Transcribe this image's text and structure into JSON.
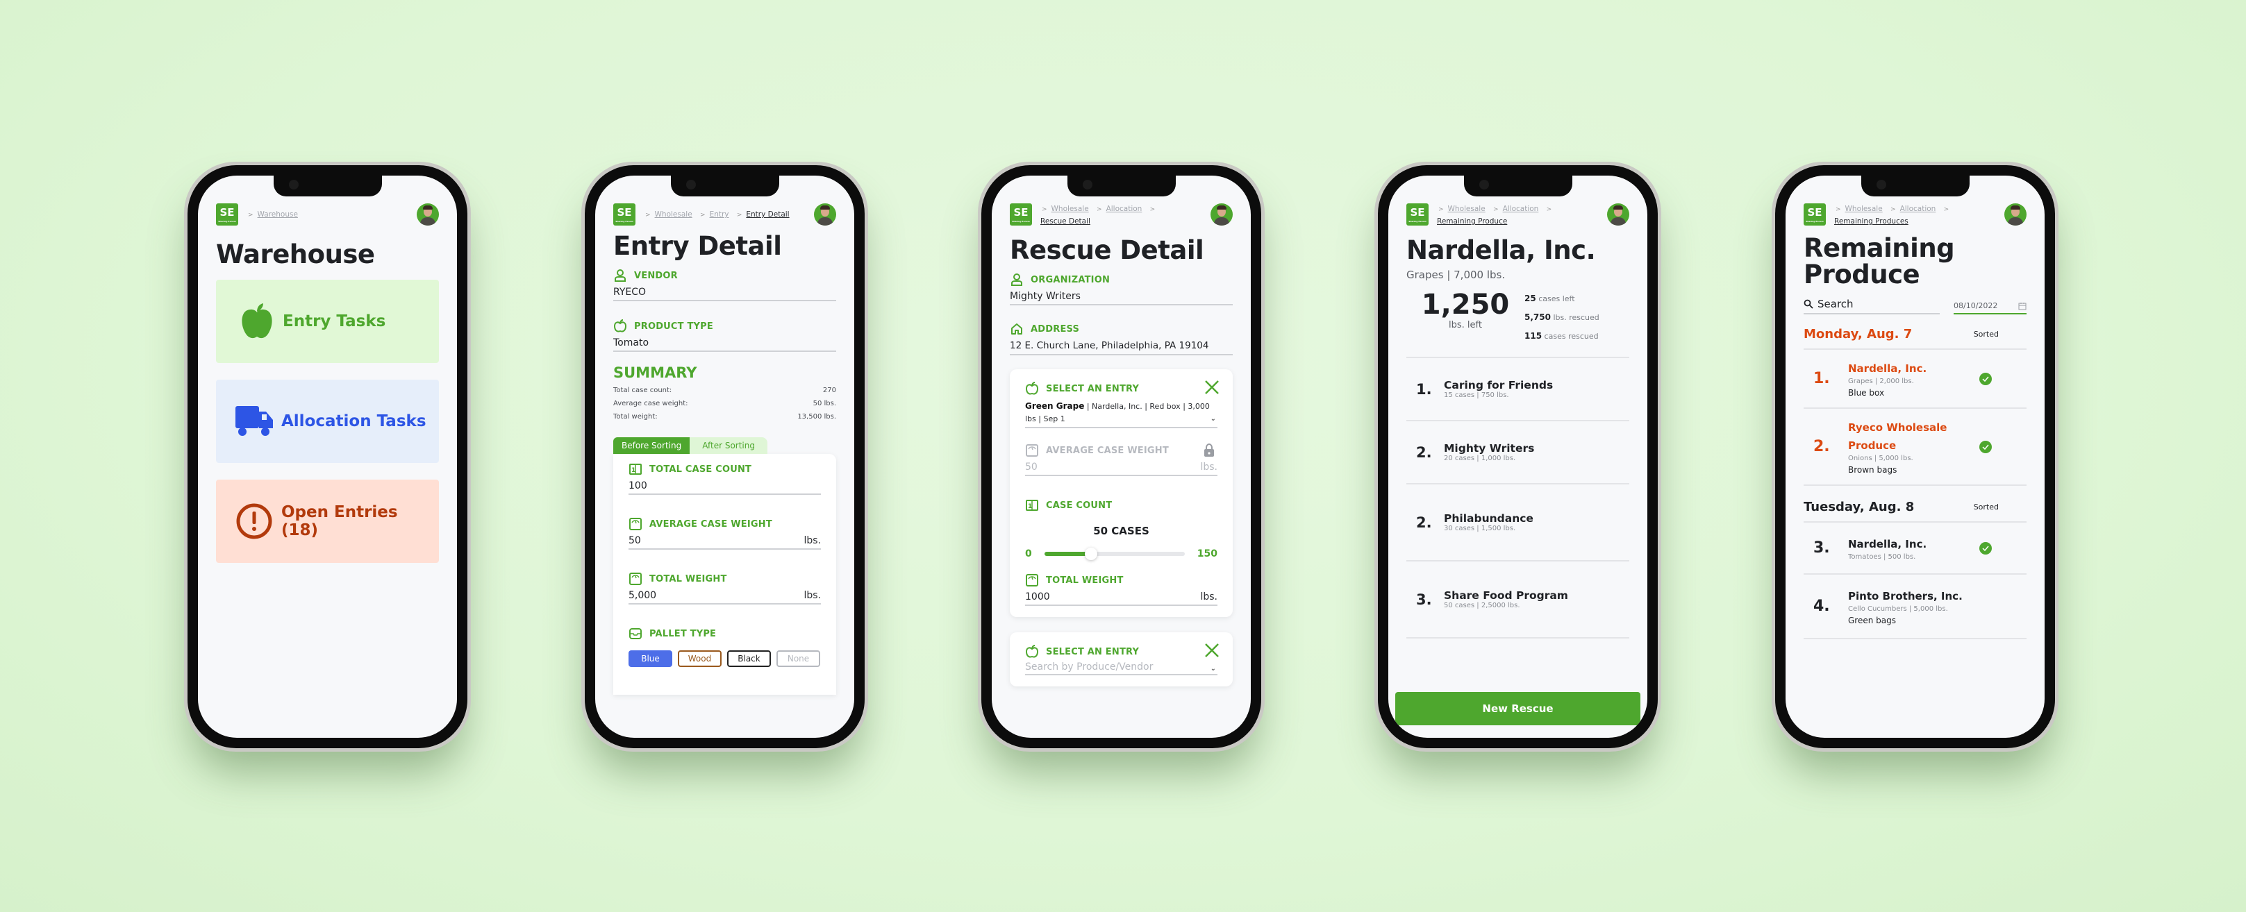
{
  "colors": {
    "brand_green": "#4ea72e",
    "allocation_blue": "#2d55e5",
    "alert_red": "#b23a0c",
    "accent_orange": "#dc4a12",
    "background": "#dff6d6"
  },
  "logo": {
    "text": "SE",
    "tagline": "Sharing Excess"
  },
  "screens": {
    "warehouse": {
      "breadcrumb": [
        "Warehouse"
      ],
      "title": "Warehouse",
      "tiles": [
        {
          "label": "Entry Tasks",
          "icon": "apple-icon"
        },
        {
          "label": "Allocation Tasks",
          "icon": "truck-icon"
        },
        {
          "label": "Open Entries (18)",
          "icon": "alert-circle-icon"
        }
      ]
    },
    "entry_detail": {
      "breadcrumb": [
        "Wholesale",
        "Entry",
        "Entry Detail"
      ],
      "title": "Entry Detail",
      "vendor": {
        "label": "VENDOR",
        "value": "RYECO"
      },
      "product_type": {
        "label": "PRODUCT TYPE",
        "value": "Tomato"
      },
      "summary": {
        "title": "SUMMARY",
        "rows": [
          {
            "label": "Total case count:",
            "value": "270"
          },
          {
            "label": "Average case weight:",
            "value": "50 lbs."
          },
          {
            "label": "Total weight:",
            "value": "13,500 lbs."
          }
        ]
      },
      "tabs": [
        "Before Sorting",
        "After Sorting"
      ],
      "active_tab": "Before Sorting",
      "fields": {
        "total_case_count": {
          "label": "TOTAL CASE COUNT",
          "value": "100"
        },
        "average_case_weight": {
          "label": "AVERAGE CASE WEIGHT",
          "value": "50",
          "unit": "lbs."
        },
        "total_weight": {
          "label": "TOTAL WEIGHT",
          "value": "5,000",
          "unit": "lbs."
        }
      },
      "pallet_type": {
        "label": "PALLET TYPE",
        "options": [
          "Blue",
          "Wood",
          "Black",
          "None"
        ],
        "selected": "Blue"
      }
    },
    "rescue_detail": {
      "breadcrumb": [
        "Wholesale",
        "Allocation",
        "Rescue Detail"
      ],
      "title": "Rescue Detail",
      "organization": {
        "label": "ORGANIZATION",
        "value": "Mighty Writers"
      },
      "address": {
        "label": "ADDRESS",
        "value": "12 E. Church Lane, Philadelphia, PA 19104"
      },
      "entry_card": {
        "label": "SELECT AN ENTRY",
        "entry_name": "Green Grape",
        "entry_details": " | Nardella, Inc. | Red box | 3,000 lbs | Sep 1",
        "avg_case_weight": {
          "label": "AVERAGE CASE WEIGHT",
          "value": "50",
          "unit": "lbs."
        },
        "case_count": {
          "label": "CASE COUNT",
          "value_label": "50 CASES",
          "min": "0",
          "max": "150",
          "value": 50,
          "min_value": 0,
          "max_value": 150
        },
        "total_weight": {
          "label": "TOTAL WEIGHT",
          "value": "1000",
          "unit": "lbs."
        }
      },
      "entry_card_2": {
        "label": "SELECT AN ENTRY",
        "placeholder": "Search by Produce/Vendor"
      }
    },
    "vendor_detail": {
      "breadcrumb": [
        "Wholesale",
        "Allocation",
        "Remaining Produce"
      ],
      "title": "Nardella, Inc.",
      "subtitle": "Grapes |  7,000 lbs.",
      "lbs_left": "1,250",
      "lbs_left_label": "lbs. left",
      "stats": [
        {
          "value": "25",
          "label": " cases left"
        },
        {
          "value": "5,750",
          "label": " lbs. rescued"
        },
        {
          "value": "115",
          "label": " cases rescued"
        }
      ],
      "rescues": [
        {
          "rank": "1.",
          "name": "Caring for Friends",
          "meta": "15 cases |  750 lbs."
        },
        {
          "rank": "2.",
          "name": "Mighty Writers",
          "meta": "20 cases |  1,000 lbs."
        },
        {
          "rank": "2.",
          "name": "Philabundance",
          "meta": "30 cases |  1,500 lbs."
        },
        {
          "rank": "3.",
          "name": "Share Food Program",
          "meta": "50 cases |  2,5000 lbs."
        }
      ],
      "new_rescue_label": "New Rescue"
    },
    "remaining_produce": {
      "breadcrumb": [
        "Wholesale",
        "Allocation",
        "Remaining Produces"
      ],
      "title": "Remaining Produce",
      "search_placeholder": "Search",
      "date": "08/10/2022",
      "days": [
        {
          "label": "Monday, Aug. 7",
          "status": "Sorted",
          "items": [
            {
              "rank": "1.",
              "name": "Nardella, Inc.",
              "meta": "Grapes |  2,000 lbs.",
              "package": "Blue box",
              "checked": true
            },
            {
              "rank": "2.",
              "name": "Ryeco Wholesale Produce",
              "meta": "Onions |  5,000 lbs.",
              "package": "Brown bags",
              "checked": true
            }
          ]
        },
        {
          "label": "Tuesday, Aug. 8",
          "status": "Sorted",
          "items": [
            {
              "rank": "3.",
              "name": "Nardella, Inc.",
              "meta": "Tomatoes |  500 lbs.",
              "package": "",
              "checked": true
            },
            {
              "rank": "4.",
              "name": "Pinto Brothers, Inc.",
              "meta": "Cello Cucumbers |  5,000 lbs.",
              "package": "Green bags",
              "checked": false
            }
          ]
        }
      ]
    }
  }
}
